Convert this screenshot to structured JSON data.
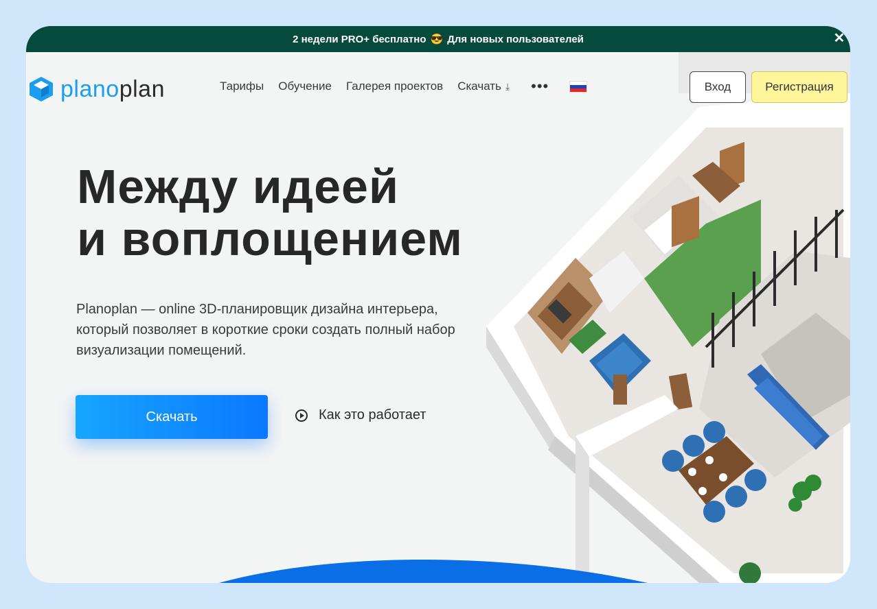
{
  "promo": {
    "text_before": "2 недели PRO+ бесплатно",
    "emoji": "😎",
    "text_after": "Для новых пользователей",
    "close": "✕"
  },
  "logo": {
    "part1": "plano",
    "part2": "plan"
  },
  "nav": {
    "items": [
      "Тарифы",
      "Обучение",
      "Галерея проектов",
      "Скачать"
    ],
    "download_icon": "⤓",
    "more": "•••",
    "language_flag": "russia-flag-icon"
  },
  "auth": {
    "login": "Вход",
    "register": "Регистрация"
  },
  "hero": {
    "title_line1": "Между идеей",
    "title_line2": "и воплощением",
    "description": "Planoplan — online 3D-планировщик дизайна интерьера, который позволяет в короткие сроки создать полный набор визуализации помещений.",
    "cta": "Скачать",
    "how_it_works": "Как это работает"
  },
  "colors": {
    "promo_bg": "#064a3b",
    "brand_blue": "#1b9df0",
    "cta_blue": "#0a78ff",
    "register_bg": "#fff59a",
    "background": "#cfe6fb"
  }
}
